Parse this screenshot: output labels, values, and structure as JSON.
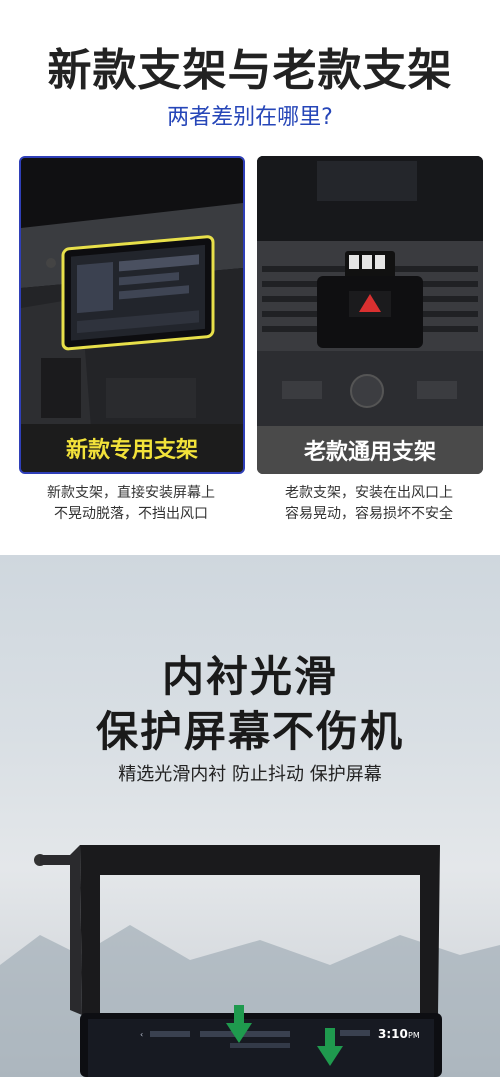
{
  "header": {
    "title": "新款支架与老款支架",
    "subtitle": "两者差别在哪里?"
  },
  "comparison": {
    "new": {
      "label": "新款专用支架",
      "description_line1": "新款支架，直接安装屏幕上",
      "description_line2": "不晃动脱落，不挡出风口"
    },
    "old": {
      "label": "老款通用支架",
      "description_line1": "老款支架，安装在出风口上",
      "description_line2": "容易晃动，容易损坏不安全"
    }
  },
  "feature": {
    "heading_line1": "内衬光滑",
    "heading_line2": "保护屏幕不伤机",
    "tagline": "精选光滑内衬 防止抖动 保护屏幕"
  },
  "screen": {
    "time": "3:10",
    "time_suffix": "PM"
  },
  "colors": {
    "accent_blue": "#2646b8",
    "label_yellow": "#f2e23a",
    "arrow_green": "#1f9a4e"
  }
}
